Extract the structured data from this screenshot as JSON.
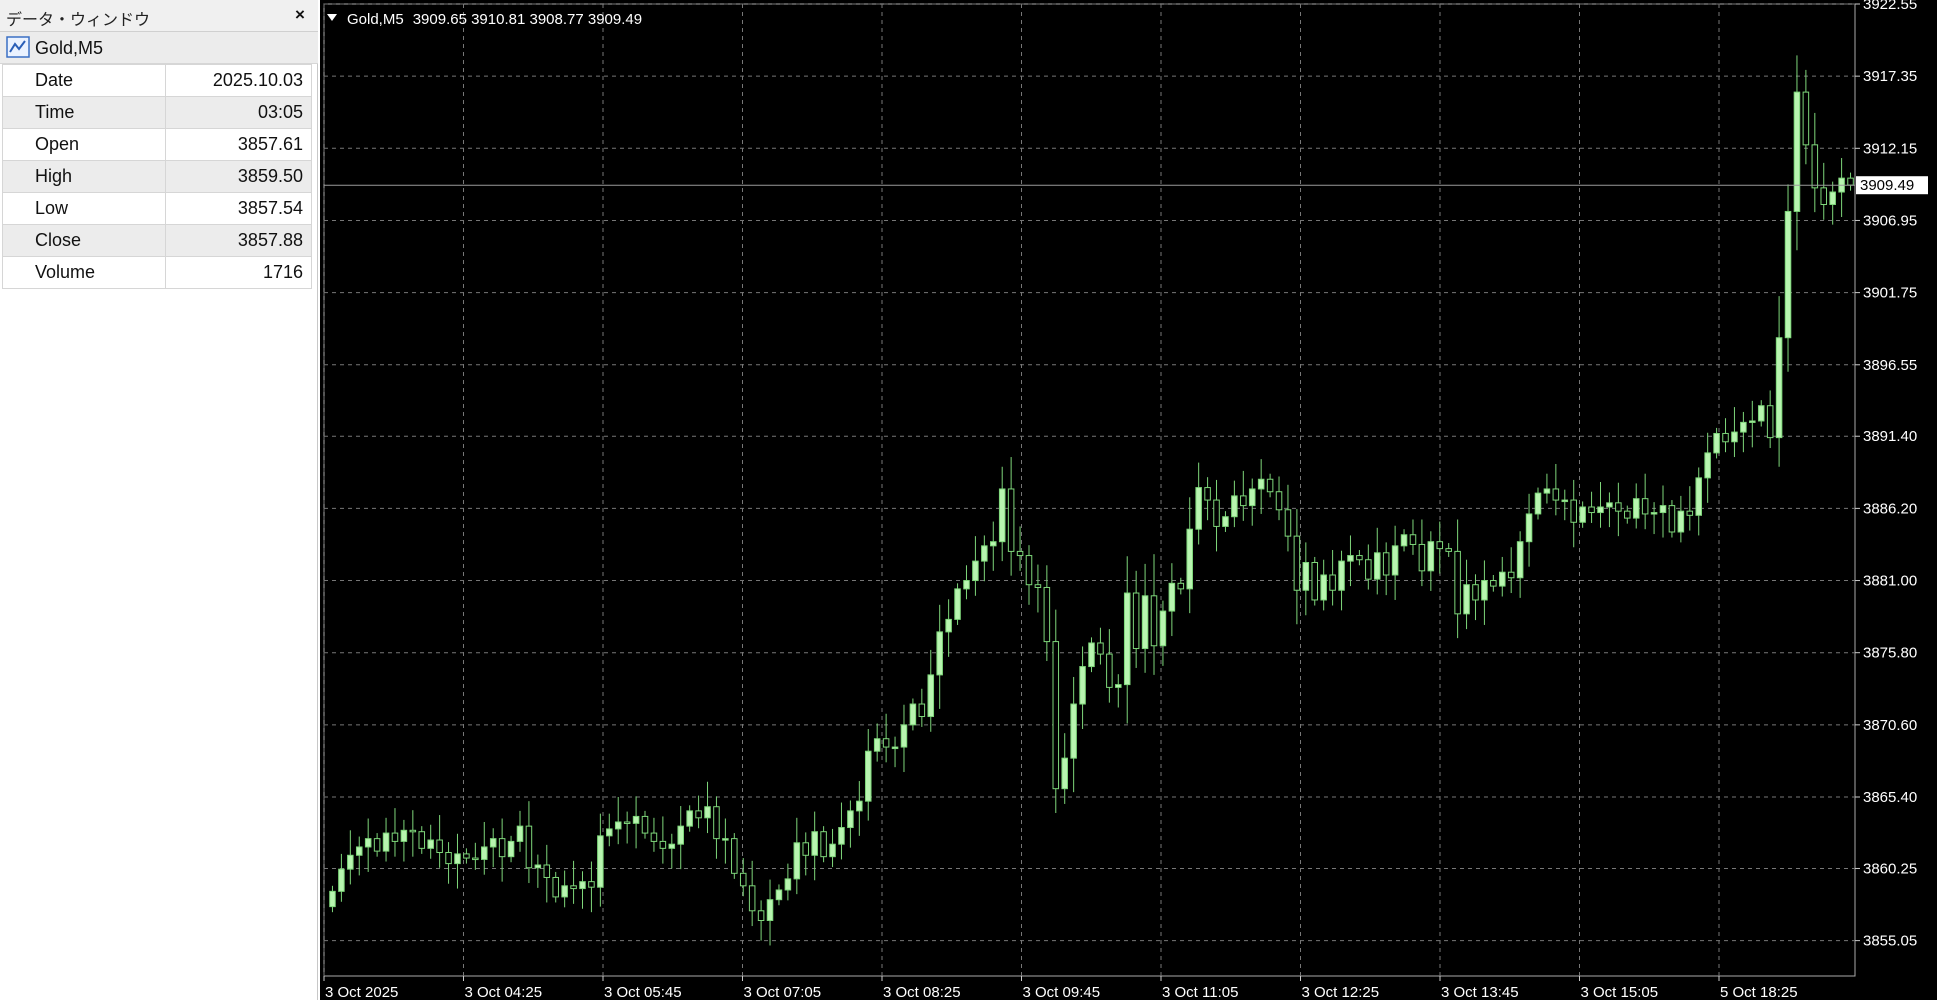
{
  "data_window": {
    "title": "データ・ウィンドウ",
    "close_glyph": "×",
    "symbol": "Gold,M5",
    "rows": [
      {
        "label": "Date",
        "value": "2025.10.03"
      },
      {
        "label": "Time",
        "value": "03:05"
      },
      {
        "label": "Open",
        "value": "3857.61"
      },
      {
        "label": "High",
        "value": "3859.50"
      },
      {
        "label": "Low",
        "value": "3857.54"
      },
      {
        "label": "Close",
        "value": "3857.88"
      },
      {
        "label": "Volume",
        "value": "1716"
      }
    ]
  },
  "chart_header": {
    "symbol": "Gold,M5",
    "ohlc": "3909.65 3910.81 3908.77 3909.49"
  },
  "chart_data": {
    "type": "candlestick",
    "bull_color": "#b8f5b0",
    "wick_color": "#7ed67a",
    "bear_color": "#000000",
    "background": "#000000",
    "grid": true,
    "current_price": "3909.49",
    "ylim": [
      3852.5,
      3922.55
    ],
    "y_ticks": [
      "3922.55",
      "3917.35",
      "3912.15",
      "3906.95",
      "3901.75",
      "3896.55",
      "3891.40",
      "3886.20",
      "3881.00",
      "3875.80",
      "3870.60",
      "3865.40",
      "3860.25",
      "3855.05"
    ],
    "x_ticks": [
      "3 Oct 2025",
      "3 Oct 04:25",
      "3 Oct 05:45",
      "3 Oct 07:05",
      "3 Oct 08:25",
      "3 Oct 09:45",
      "3 Oct 11:05",
      "3 Oct 12:25",
      "3 Oct 13:45",
      "3 Oct 15:05",
      "5 Oct 18:25"
    ],
    "close": [
      3858.6,
      3860.2,
      3861.2,
      3861.8,
      3862.4,
      3861.5,
      3862.8,
      3862.2,
      3863.0,
      3862.9,
      3861.7,
      3862.3,
      3861.4,
      3860.6,
      3861.3,
      3861.0,
      3860.9,
      3861.8,
      3862.4,
      3861.1,
      3862.2,
      3863.3,
      3860.3,
      3860.5,
      3859.6,
      3858.2,
      3859.0,
      3858.8,
      3859.3,
      3858.9,
      3862.6,
      3863.1,
      3863.6,
      3863.5,
      3864.0,
      3862.8,
      3862.2,
      3861.7,
      3862.0,
      3863.3,
      3864.4,
      3863.9,
      3864.7,
      3862.4,
      3862.4,
      3859.9,
      3859.0,
      3857.2,
      3856.5,
      3858.0,
      3858.7,
      3859.5,
      3862.1,
      3861.2,
      3862.9,
      3861.1,
      3862.0,
      3863.2,
      3864.4,
      3865.1,
      3868.7,
      3869.6,
      3869.0,
      3869.0,
      3870.6,
      3872.1,
      3871.2,
      3874.2,
      3877.3,
      3878.2,
      3880.4,
      3881.0,
      3882.4,
      3883.5,
      3883.8,
      3887.6,
      3883.1,
      3882.8,
      3880.7,
      3880.5,
      3876.6,
      3866.0,
      3868.2,
      3872.1,
      3874.8,
      3876.5,
      3875.7,
      3873.3,
      3873.5,
      3880.1,
      3876.1,
      3879.9,
      3876.3,
      3878.8,
      3880.8,
      3880.4,
      3884.7,
      3887.7,
      3886.8,
      3884.9,
      3885.6,
      3887.1,
      3886.4,
      3887.6,
      3888.3,
      3887.4,
      3886.1,
      3884.2,
      3880.3,
      3882.3,
      3879.6,
      3881.4,
      3880.3,
      3882.4,
      3882.8,
      3882.5,
      3881.1,
      3883.0,
      3881.4,
      3883.5,
      3884.3,
      3883.6,
      3881.7,
      3883.8,
      3883.3,
      3883.1,
      3878.6,
      3880.7,
      3879.6,
      3881.0,
      3880.6,
      3881.6,
      3881.2,
      3883.8,
      3885.8,
      3887.3,
      3887.6,
      3886.8,
      3886.8,
      3885.2,
      3886.3,
      3885.9,
      3886.3,
      3886.6,
      3886.0,
      3885.5,
      3886.9,
      3885.8,
      3885.9,
      3886.4,
      3884.5,
      3886.0,
      3885.7,
      3888.4,
      3890.2,
      3891.6,
      3891.0,
      3891.7,
      3892.4,
      3892.5,
      3893.6,
      3891.3,
      3898.5,
      3907.6,
      3916.2,
      3912.4,
      3909.3,
      3908.1,
      3909.0,
      3910.0,
      3909.5
    ],
    "open": [
      3857.5,
      3858.6,
      3860.2,
      3861.2,
      3861.8,
      3862.4,
      3861.5,
      3862.8,
      3862.2,
      3863.0,
      3862.9,
      3861.7,
      3862.3,
      3861.4,
      3860.6,
      3861.3,
      3861.0,
      3860.9,
      3861.8,
      3862.4,
      3861.1,
      3862.2,
      3863.3,
      3860.3,
      3860.5,
      3859.6,
      3858.2,
      3859.0,
      3858.8,
      3859.3,
      3858.9,
      3862.6,
      3863.1,
      3863.6,
      3863.5,
      3864.0,
      3862.8,
      3862.2,
      3861.7,
      3862.0,
      3863.3,
      3864.4,
      3863.9,
      3864.7,
      3862.4,
      3862.4,
      3859.9,
      3859.0,
      3857.2,
      3856.5,
      3858.0,
      3858.7,
      3859.5,
      3862.1,
      3861.2,
      3862.9,
      3861.1,
      3862.0,
      3863.2,
      3864.4,
      3865.1,
      3868.7,
      3869.6,
      3869.0,
      3869.0,
      3870.6,
      3872.1,
      3871.2,
      3874.2,
      3877.3,
      3878.2,
      3880.4,
      3881.0,
      3882.4,
      3883.5,
      3883.8,
      3887.6,
      3883.1,
      3882.8,
      3880.7,
      3880.5,
      3876.6,
      3866.0,
      3868.2,
      3872.1,
      3874.8,
      3876.5,
      3875.7,
      3873.3,
      3873.5,
      3880.1,
      3876.1,
      3879.9,
      3876.3,
      3878.8,
      3880.8,
      3880.4,
      3884.7,
      3887.7,
      3886.8,
      3884.9,
      3885.6,
      3887.1,
      3886.4,
      3887.6,
      3888.3,
      3887.4,
      3886.1,
      3884.2,
      3880.3,
      3882.3,
      3879.6,
      3881.4,
      3880.3,
      3882.4,
      3882.8,
      3882.5,
      3881.1,
      3883.0,
      3881.4,
      3883.5,
      3884.3,
      3883.6,
      3881.7,
      3883.8,
      3883.3,
      3883.1,
      3878.6,
      3880.7,
      3879.6,
      3881.0,
      3880.6,
      3881.6,
      3881.2,
      3883.8,
      3885.8,
      3887.3,
      3887.6,
      3886.8,
      3886.8,
      3885.2,
      3886.3,
      3885.9,
      3886.3,
      3886.6,
      3886.0,
      3885.5,
      3886.9,
      3885.8,
      3885.9,
      3886.4,
      3884.5,
      3886.0,
      3885.7,
      3888.4,
      3890.2,
      3891.6,
      3891.0,
      3891.7,
      3892.4,
      3892.5,
      3893.6,
      3891.3,
      3898.5,
      3907.6,
      3916.2,
      3912.4,
      3909.3,
      3908.1,
      3909.0,
      3910.0
    ]
  }
}
